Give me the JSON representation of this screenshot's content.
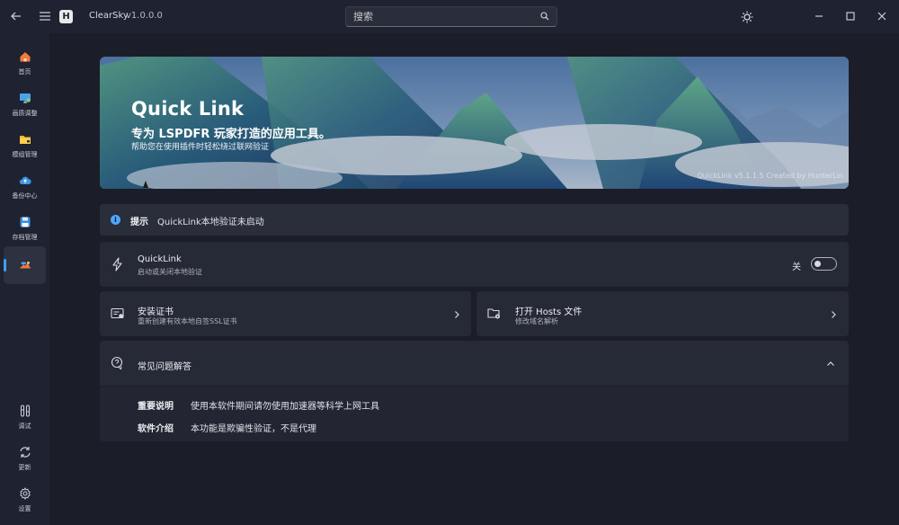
{
  "app": {
    "title": "ClearSky",
    "version": "v1.0.0.0"
  },
  "search": {
    "placeholder": "搜索"
  },
  "sidebar": {
    "items": [
      {
        "label": "首页",
        "icon": "home-icon"
      },
      {
        "label": "画质调整",
        "icon": "display-icon"
      },
      {
        "label": "模组管理",
        "icon": "folder-icon"
      },
      {
        "label": "备份中心",
        "icon": "cloud-icon"
      },
      {
        "label": "存档管理",
        "icon": "save-icon"
      },
      {
        "label": "",
        "icon": "link-tool-icon"
      },
      {
        "label": "调试",
        "icon": "tools-icon"
      },
      {
        "label": "更新",
        "icon": "refresh-icon"
      },
      {
        "label": "设置",
        "icon": "gear-icon"
      }
    ]
  },
  "banner": {
    "title": "Quick Link",
    "subtitle": "专为 LSPDFR 玩家打造的应用工具。",
    "description": "帮助您在使用插件时轻松绕过联网验证",
    "credit": "QuickLink v5.1.1.5 Created by HunterLin"
  },
  "tip": {
    "title": "提示",
    "message": "QuickLink本地验证未启动"
  },
  "quicklink": {
    "title": "QuickLink",
    "description": "启动或关闭本地验证",
    "toggle_label": "关",
    "toggle_on": false
  },
  "cert": {
    "title": "安装证书",
    "description": "重新创建有效本地自签SSL证书"
  },
  "hosts": {
    "title": "打开 Hosts 文件",
    "description": "修改域名解析"
  },
  "faq": {
    "title": "常见问题解答",
    "items": [
      {
        "key": "重要说明",
        "value": "使用本软件期间请勿使用加速器等科学上网工具"
      },
      {
        "key": "软件介绍",
        "value": "本功能是欺骗性验证，不是代理"
      }
    ]
  },
  "colors": {
    "accent": "#3aa0ff",
    "background": "#1b1e29",
    "card": "#262936"
  }
}
